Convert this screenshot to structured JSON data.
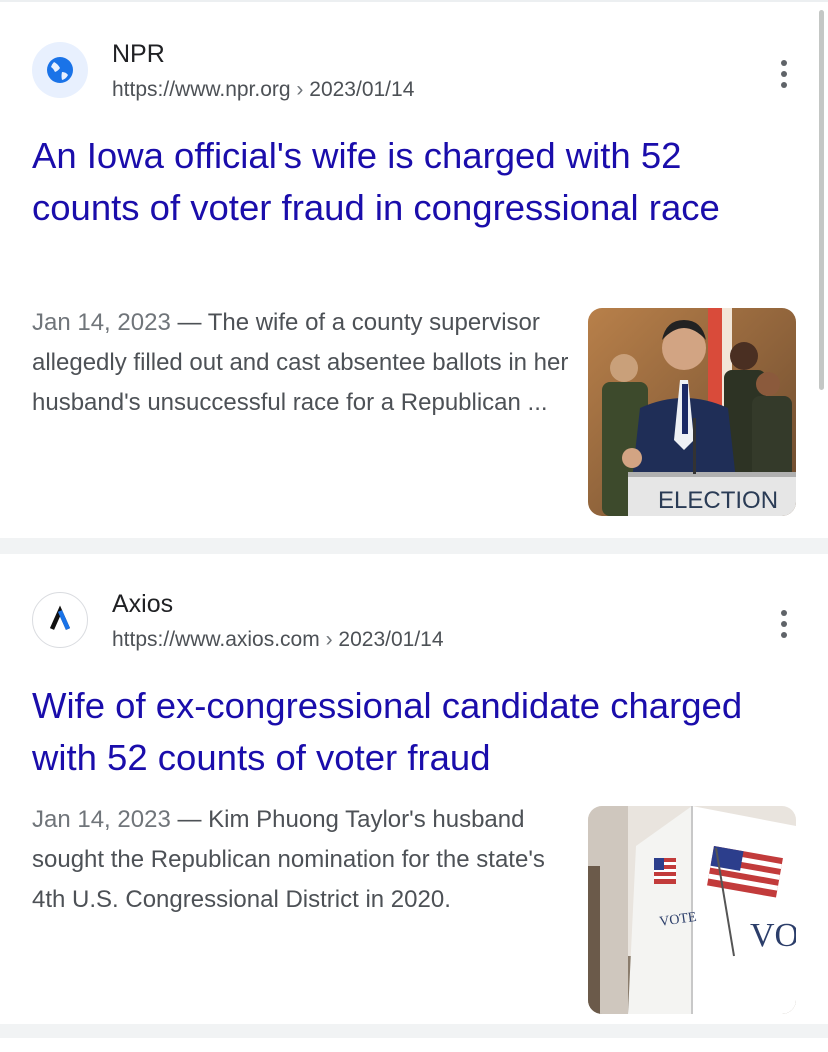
{
  "results": [
    {
      "site_name": "NPR",
      "url": "https://www.npr.org",
      "url_sep": " › ",
      "url_date": "2023/01/14",
      "headline": "An Iowa official's wife is charged with 52 counts of voter fraud in congressional race",
      "date": "Jan 14, 2023",
      "dash": " — ",
      "snippet": "The wife of a county supervisor allegedly filled out and cast absentee ballots in her husband's unsuccessful race for a Republican ...",
      "thumbnail_text": "ELECTION",
      "favicon": "globe-icon",
      "thumbnail": "press-conference-photo"
    },
    {
      "site_name": "Axios",
      "url": "https://www.axios.com",
      "url_sep": " › ",
      "url_date": "2023/01/14",
      "headline": "Wife of ex-congressional candidate charged with 52 counts of voter fraud",
      "date": "Jan 14, 2023",
      "dash": " — ",
      "snippet": "Kim Phuong Taylor's husband sought the Republican nomination for the state's 4th U.S. Congressional District in 2020.",
      "thumbnail_text": "VOTE",
      "favicon": "axios-logo-icon",
      "thumbnail": "voting-booth-photo"
    }
  ],
  "colors": {
    "link": "#1a0dab",
    "text": "#4d5156",
    "favicon_npr": "#1a73e8"
  }
}
